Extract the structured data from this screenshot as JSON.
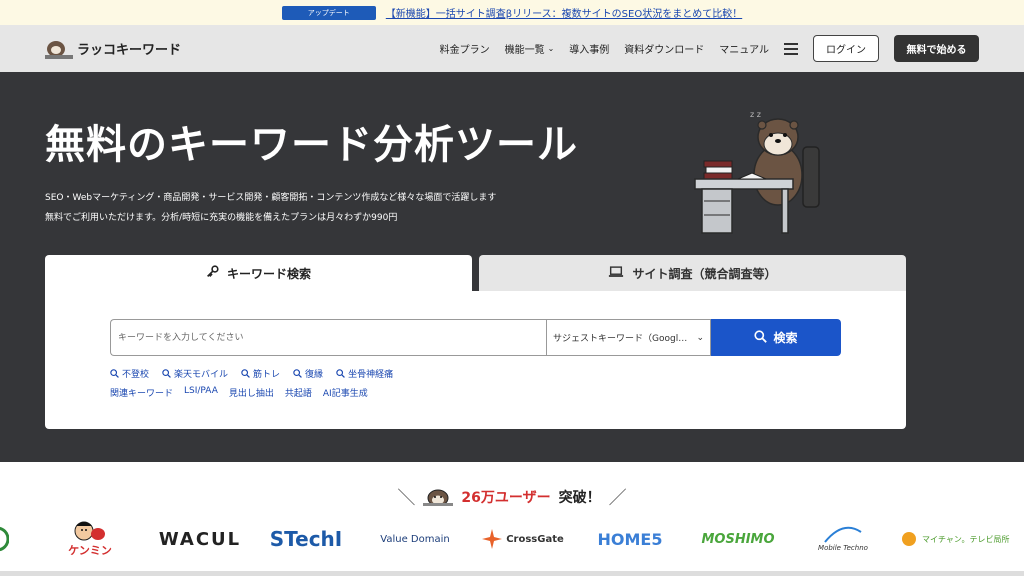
{
  "announcement": {
    "badge": "アップデート",
    "link": "【新機能】一括サイト調査βリリース：複数サイトのSEO状況をまとめて比較！"
  },
  "header": {
    "logo_text": "ラッコキーワード",
    "nav": [
      "料金プラン",
      "機能一覧",
      "導入事例",
      "資料ダウンロード",
      "マニュアル"
    ],
    "login": "ログイン",
    "start": "無料で始める"
  },
  "hero": {
    "title": "無料のキーワード分析ツール",
    "desc1": "SEO・Webマーケティング・商品開発・サービス開発・顧客開拓・コンテンツ作成など様々な場面で活躍します",
    "desc2": "無料でご利用いただけます。分析/時短に充実の機能を備えたプランは月々わずか990円"
  },
  "search": {
    "tab_keyword": "キーワード検索",
    "tab_site": "サイト調査（競合調査等）",
    "placeholder": "キーワードを入力してください",
    "suggest_select": "サジェストキーワード（Googl…",
    "button": "検索",
    "examples": [
      "不登校",
      "楽天モバイル",
      "筋トレ",
      "復縁",
      "坐骨神経痛"
    ],
    "tools": [
      "関連キーワード",
      "LSI/PAA",
      "見出し抽出",
      "共起語",
      "AI記事生成"
    ]
  },
  "users": {
    "count": "26万ユーザー",
    "suffix": "突破！",
    "logos": [
      "ケンミン",
      "WACUL",
      "STechI",
      "Value Domain",
      "CrossGate",
      "HOME5",
      "MOSHIMO",
      "Mobile Techno",
      "マイチャン。テレビ局所"
    ]
  },
  "colors": {
    "accent": "#1b55c9",
    "hero_bg": "#353639",
    "announce_bg": "#fdf9e4",
    "highlight": "#d32f2f"
  }
}
